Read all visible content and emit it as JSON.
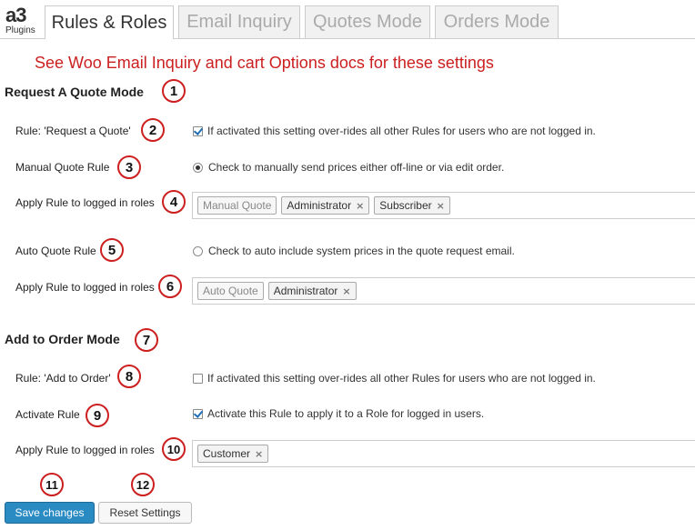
{
  "logo": {
    "main": "a3",
    "sub": "Plugins"
  },
  "tabs": [
    {
      "label": "Rules & Roles",
      "active": true
    },
    {
      "label": "Email Inquiry",
      "active": false
    },
    {
      "label": "Quotes Mode",
      "active": false
    },
    {
      "label": "Orders Mode",
      "active": false
    }
  ],
  "docs_note": "See Woo Email Inquiry and cart Options docs for these settings",
  "quote_section": {
    "title": "Request A Quote Mode",
    "rule_request_quote": {
      "label": "Rule: 'Request a Quote'",
      "option": "If activated this setting over-rides all other Rules for users who are not logged in.",
      "checked": true
    },
    "manual_quote_rule": {
      "label": "Manual Quote Rule",
      "option": "Check to manually send prices either off-line or via edit order.",
      "selected": true
    },
    "manual_roles": {
      "label": "Apply Rule to logged in roles",
      "tags": [
        {
          "name": "Manual Quote",
          "removable": false
        },
        {
          "name": "Administrator",
          "removable": true
        },
        {
          "name": "Subscriber",
          "removable": true
        }
      ]
    },
    "auto_quote_rule": {
      "label": "Auto Quote Rule",
      "option": "Check to auto include system prices in the quote request email.",
      "selected": false
    },
    "auto_roles": {
      "label": "Apply Rule to logged in roles",
      "tags": [
        {
          "name": "Auto Quote",
          "removable": false
        },
        {
          "name": "Administrator",
          "removable": true
        }
      ]
    }
  },
  "order_section": {
    "title": "Add to Order Mode",
    "rule_add_order": {
      "label": "Rule: 'Add to Order'",
      "option": "If activated this setting over-rides all other Rules for users who are not logged in.",
      "checked": false
    },
    "activate_rule": {
      "label": "Activate Rule",
      "option": "Activate this Rule to apply it to a Role for logged in users.",
      "checked": true
    },
    "order_roles": {
      "label": "Apply Rule to logged in roles",
      "tags": [
        {
          "name": "Customer",
          "removable": true
        }
      ]
    }
  },
  "markers": [
    "1",
    "2",
    "3",
    "4",
    "5",
    "6",
    "7",
    "8",
    "9",
    "10",
    "11",
    "12"
  ],
  "buttons": {
    "save": "Save changes",
    "reset": "Reset Settings"
  },
  "icons": {
    "remove_tag": "×"
  },
  "colors": {
    "annotation_red": "#cc1f1f",
    "primary_button": "#2a8bc3"
  }
}
